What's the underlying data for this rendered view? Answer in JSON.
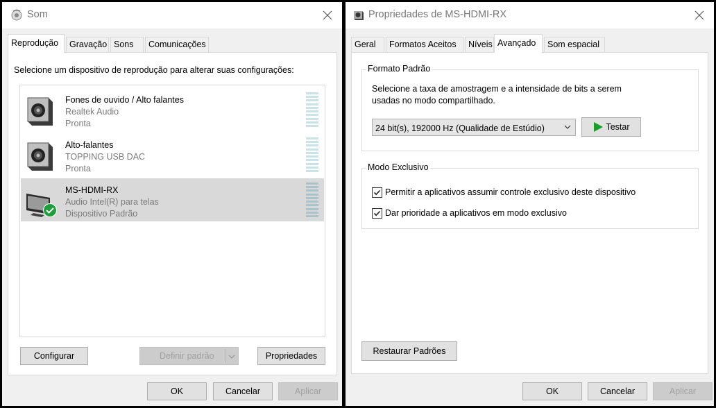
{
  "som": {
    "title": "Som",
    "tabs": [
      "Reprodução",
      "Gravação",
      "Sons",
      "Comunicações"
    ],
    "instruction": "Selecione um dispositivo de reprodução para alterar suas configurações:",
    "devices": [
      {
        "name": "Fones de ouvido / Alto falantes",
        "driver": "Realtek Audio",
        "status": "Pronta",
        "icon": "speaker-icon"
      },
      {
        "name": "Alto-falantes",
        "driver": "TOPPING USB DAC",
        "status": "Pronta",
        "icon": "speaker-icon"
      },
      {
        "name": "MS-HDMI-RX",
        "driver": "Audio Intel(R) para telas",
        "status": "Dispositivo Padrão",
        "icon": "monitor-icon"
      }
    ],
    "buttons": {
      "configure": "Configurar",
      "set_default": "Definir padrão",
      "properties": "Propriedades",
      "ok": "OK",
      "cancel": "Cancelar",
      "apply": "Aplicar"
    }
  },
  "props": {
    "title": "Propriedades de MS-HDMI-RX",
    "tabs": [
      "Geral",
      "Formatos Aceitos",
      "Níveis",
      "Avançado",
      "Som espacial"
    ],
    "format_group": "Formato Padrão",
    "format_desc_1": "Selecione a taxa de amostragem e a intensidade de bits a serem",
    "format_desc_2": "usadas no modo compartilhado.",
    "format_value": "24 bit(s), 192000 Hz (Qualidade de Estúdio)",
    "test_button": "Testar",
    "exclusive_group": "Modo Exclusivo",
    "exclusive_options": [
      {
        "label": "Permitir a aplicativos assumir controle exclusivo deste dispositivo",
        "checked": true
      },
      {
        "label": "Dar prioridade a aplicativos em modo exclusivo",
        "checked": true
      }
    ],
    "buttons": {
      "restore": "Restaurar Padrões",
      "ok": "OK",
      "cancel": "Cancelar",
      "apply": "Aplicar"
    }
  },
  "colors": {
    "selected_row": "#d9d9d9",
    "check_green": "#1e9f3a",
    "play_green": "#1a9d2a"
  }
}
